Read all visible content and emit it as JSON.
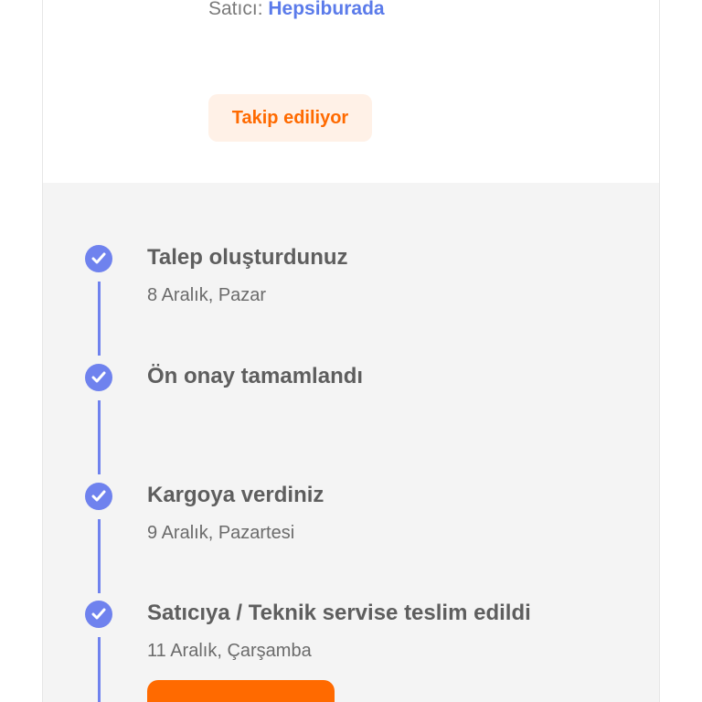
{
  "seller": {
    "label": "Satıcı:",
    "name": "Hepsiburada"
  },
  "status_badge": {
    "label": "Takip ediliyor"
  },
  "timeline": {
    "steps": [
      {
        "title": "Talep oluşturdunuz",
        "date": "8 Aralık, Pazar",
        "icon": "check-circle-icon"
      },
      {
        "title": "Ön onay tamamlandı",
        "date": "",
        "icon": "check-circle-icon"
      },
      {
        "title": "Kargoya verdiniz",
        "date": "9 Aralık, Pazartesi",
        "icon": "check-circle-icon"
      },
      {
        "title": "Satıcıya / Teknik servise teslim edildi",
        "date": "11 Aralık, Çarşamba",
        "icon": "check-circle-icon"
      }
    ]
  },
  "colors": {
    "accent_blue": "#6f82ee",
    "accent_orange": "#ff6a00",
    "badge_bg": "#fff1e7",
    "panel_bg": "#f4f4f4"
  }
}
